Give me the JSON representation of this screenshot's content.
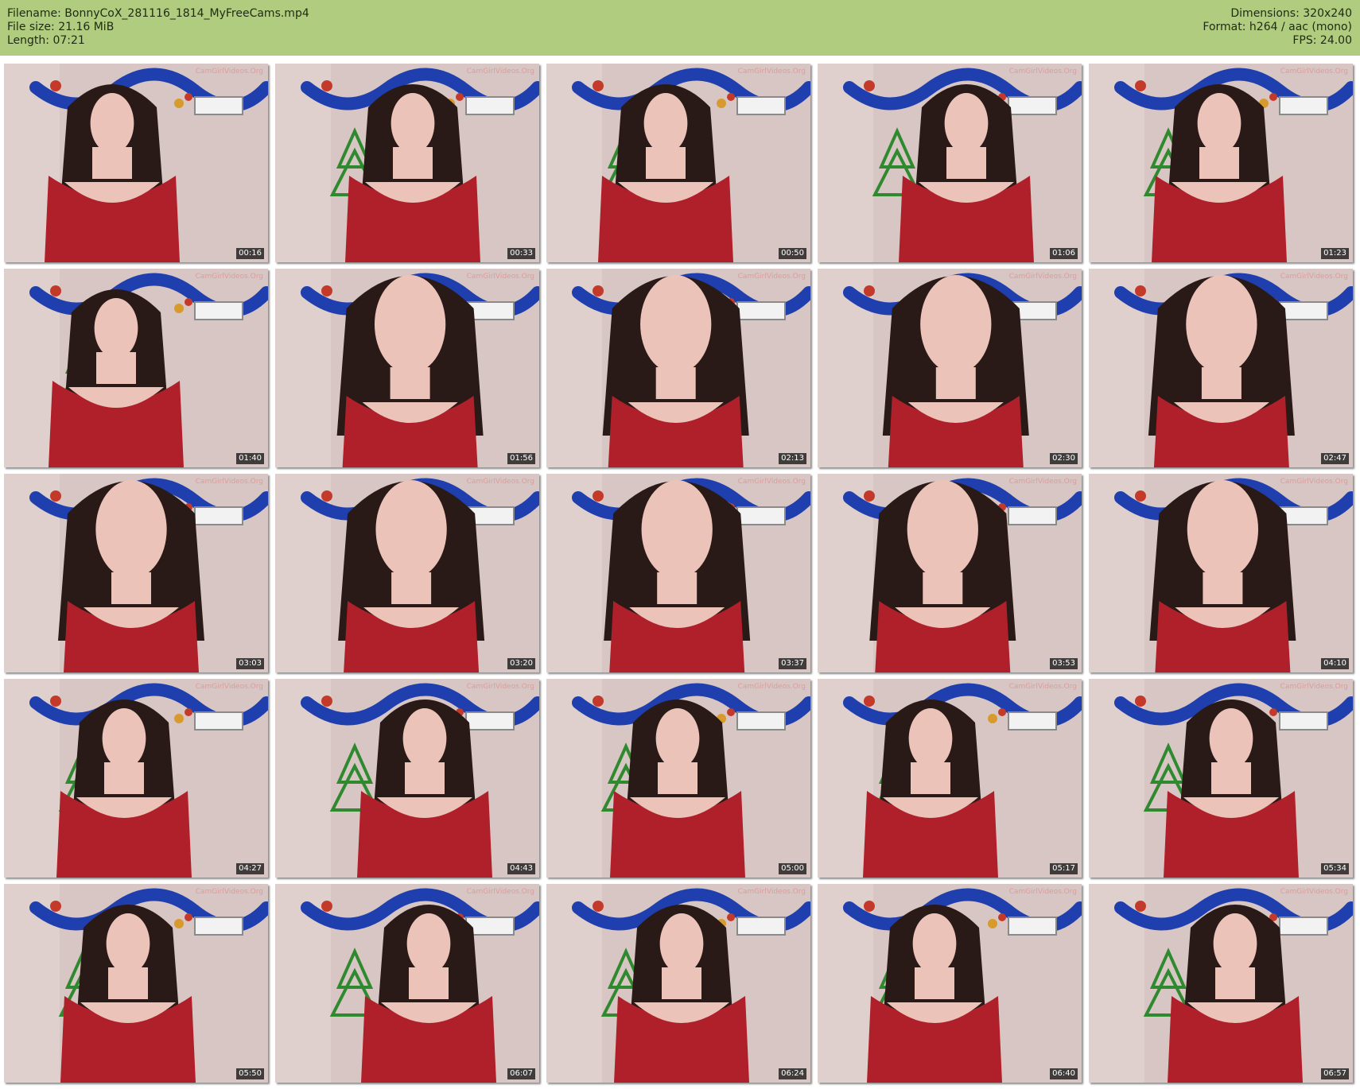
{
  "header": {
    "filename": "Filename: BonnyCoX_281116_1814_MyFreeCams.mp4",
    "file_size": "File size: 21.16 MiB",
    "length": "Length: 07:21",
    "dimensions": "Dimensions: 320x240",
    "format": "Format: h264 / aac (mono)",
    "fps": "FPS: 24.00"
  },
  "thumbnails": [
    {
      "time": "00:16",
      "watermark": "CamGirlVideos.Org"
    },
    {
      "time": "00:33",
      "watermark": "CamGirlVideos.Org"
    },
    {
      "time": "00:50",
      "watermark": "CamGirlVideos.Org"
    },
    {
      "time": "01:06",
      "watermark": "CamGirlVideos.Org"
    },
    {
      "time": "01:23",
      "watermark": "CamGirlVideos.Org"
    },
    {
      "time": "01:40",
      "watermark": "CamGirlVideos.Org"
    },
    {
      "time": "01:56",
      "watermark": "CamGirlVideos.Org"
    },
    {
      "time": "02:13",
      "watermark": "CamGirlVideos.Org"
    },
    {
      "time": "02:30",
      "watermark": "CamGirlVideos.Org"
    },
    {
      "time": "02:47",
      "watermark": "CamGirlVideos.Org"
    },
    {
      "time": "03:03",
      "watermark": "CamGirlVideos.Org"
    },
    {
      "time": "03:20",
      "watermark": "CamGirlVideos.Org"
    },
    {
      "time": "03:37",
      "watermark": "CamGirlVideos.Org"
    },
    {
      "time": "03:53",
      "watermark": "CamGirlVideos.Org"
    },
    {
      "time": "04:10",
      "watermark": "CamGirlVideos.Org"
    },
    {
      "time": "04:27",
      "watermark": "CamGirlVideos.Org"
    },
    {
      "time": "04:43",
      "watermark": "CamGirlVideos.Org"
    },
    {
      "time": "05:00",
      "watermark": "CamGirlVideos.Org"
    },
    {
      "time": "05:17",
      "watermark": "CamGirlVideos.Org"
    },
    {
      "time": "05:34",
      "watermark": "CamGirlVideos.Org"
    },
    {
      "time": "05:50",
      "watermark": "CamGirlVideos.Org"
    },
    {
      "time": "06:07",
      "watermark": "CamGirlVideos.Org"
    },
    {
      "time": "06:24",
      "watermark": "CamGirlVideos.Org"
    },
    {
      "time": "06:40",
      "watermark": "CamGirlVideos.Org"
    },
    {
      "time": "06:57",
      "watermark": "CamGirlVideos.Org"
    }
  ],
  "colors": {
    "header_bg": "#b0cc7f",
    "wall": "#d8c6c4",
    "garland": "#1f3fae",
    "dress": "#b0202a",
    "hair": "#2a1a17",
    "skin": "#ecc3b8",
    "tree": "#2f8a2f"
  }
}
